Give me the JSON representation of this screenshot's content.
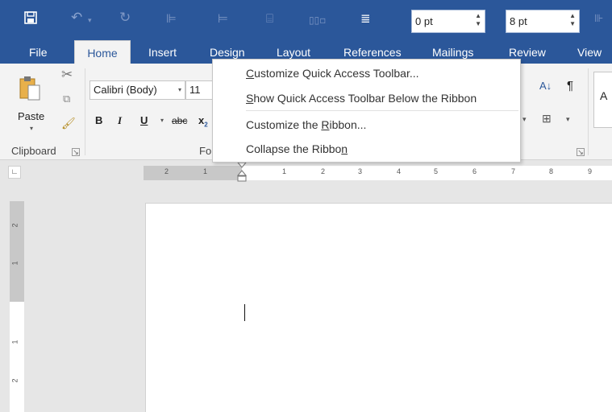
{
  "qat": {
    "fields": [
      {
        "value": "0 pt"
      },
      {
        "value": "8 pt"
      }
    ]
  },
  "tabs": [
    "File",
    "Home",
    "Insert",
    "Design",
    "Layout",
    "References",
    "Mailings",
    "Review",
    "View"
  ],
  "ribbon": {
    "paste_label": "Paste",
    "font_name": "Calibri (Body)",
    "font_size": "11",
    "bold": "B",
    "italic": "I",
    "underline": "U",
    "strikethrough": "abc",
    "subscript": "x",
    "subscript_mark": "2",
    "clipboard_label": "Clipboard",
    "font_group_partial": "Fo",
    "sort_glyph": "A↓",
    "pilcrow": "¶",
    "style_preview": "A"
  },
  "context_menu": {
    "items": [
      {
        "pre": "",
        "accel": "C",
        "post": "ustomize Quick Access Toolbar..."
      },
      {
        "pre": "",
        "accel": "S",
        "post": "how Quick Access Toolbar Below the Ribbon"
      },
      {
        "pre": "Customize the ",
        "accel": "R",
        "post": "ibbon..."
      },
      {
        "pre": "Collapse the Ribbo",
        "accel": "n",
        "post": ""
      }
    ]
  },
  "ruler": {
    "h_labels": [
      "2",
      "1",
      "1",
      "2",
      "3",
      "4",
      "5",
      "6",
      "7",
      "8",
      "9"
    ],
    "v_labels": [
      "2",
      "1",
      "1",
      "2"
    ]
  },
  "icons": {
    "save": "save-icon",
    "undo": "undo-icon",
    "redo": "redo-icon"
  }
}
